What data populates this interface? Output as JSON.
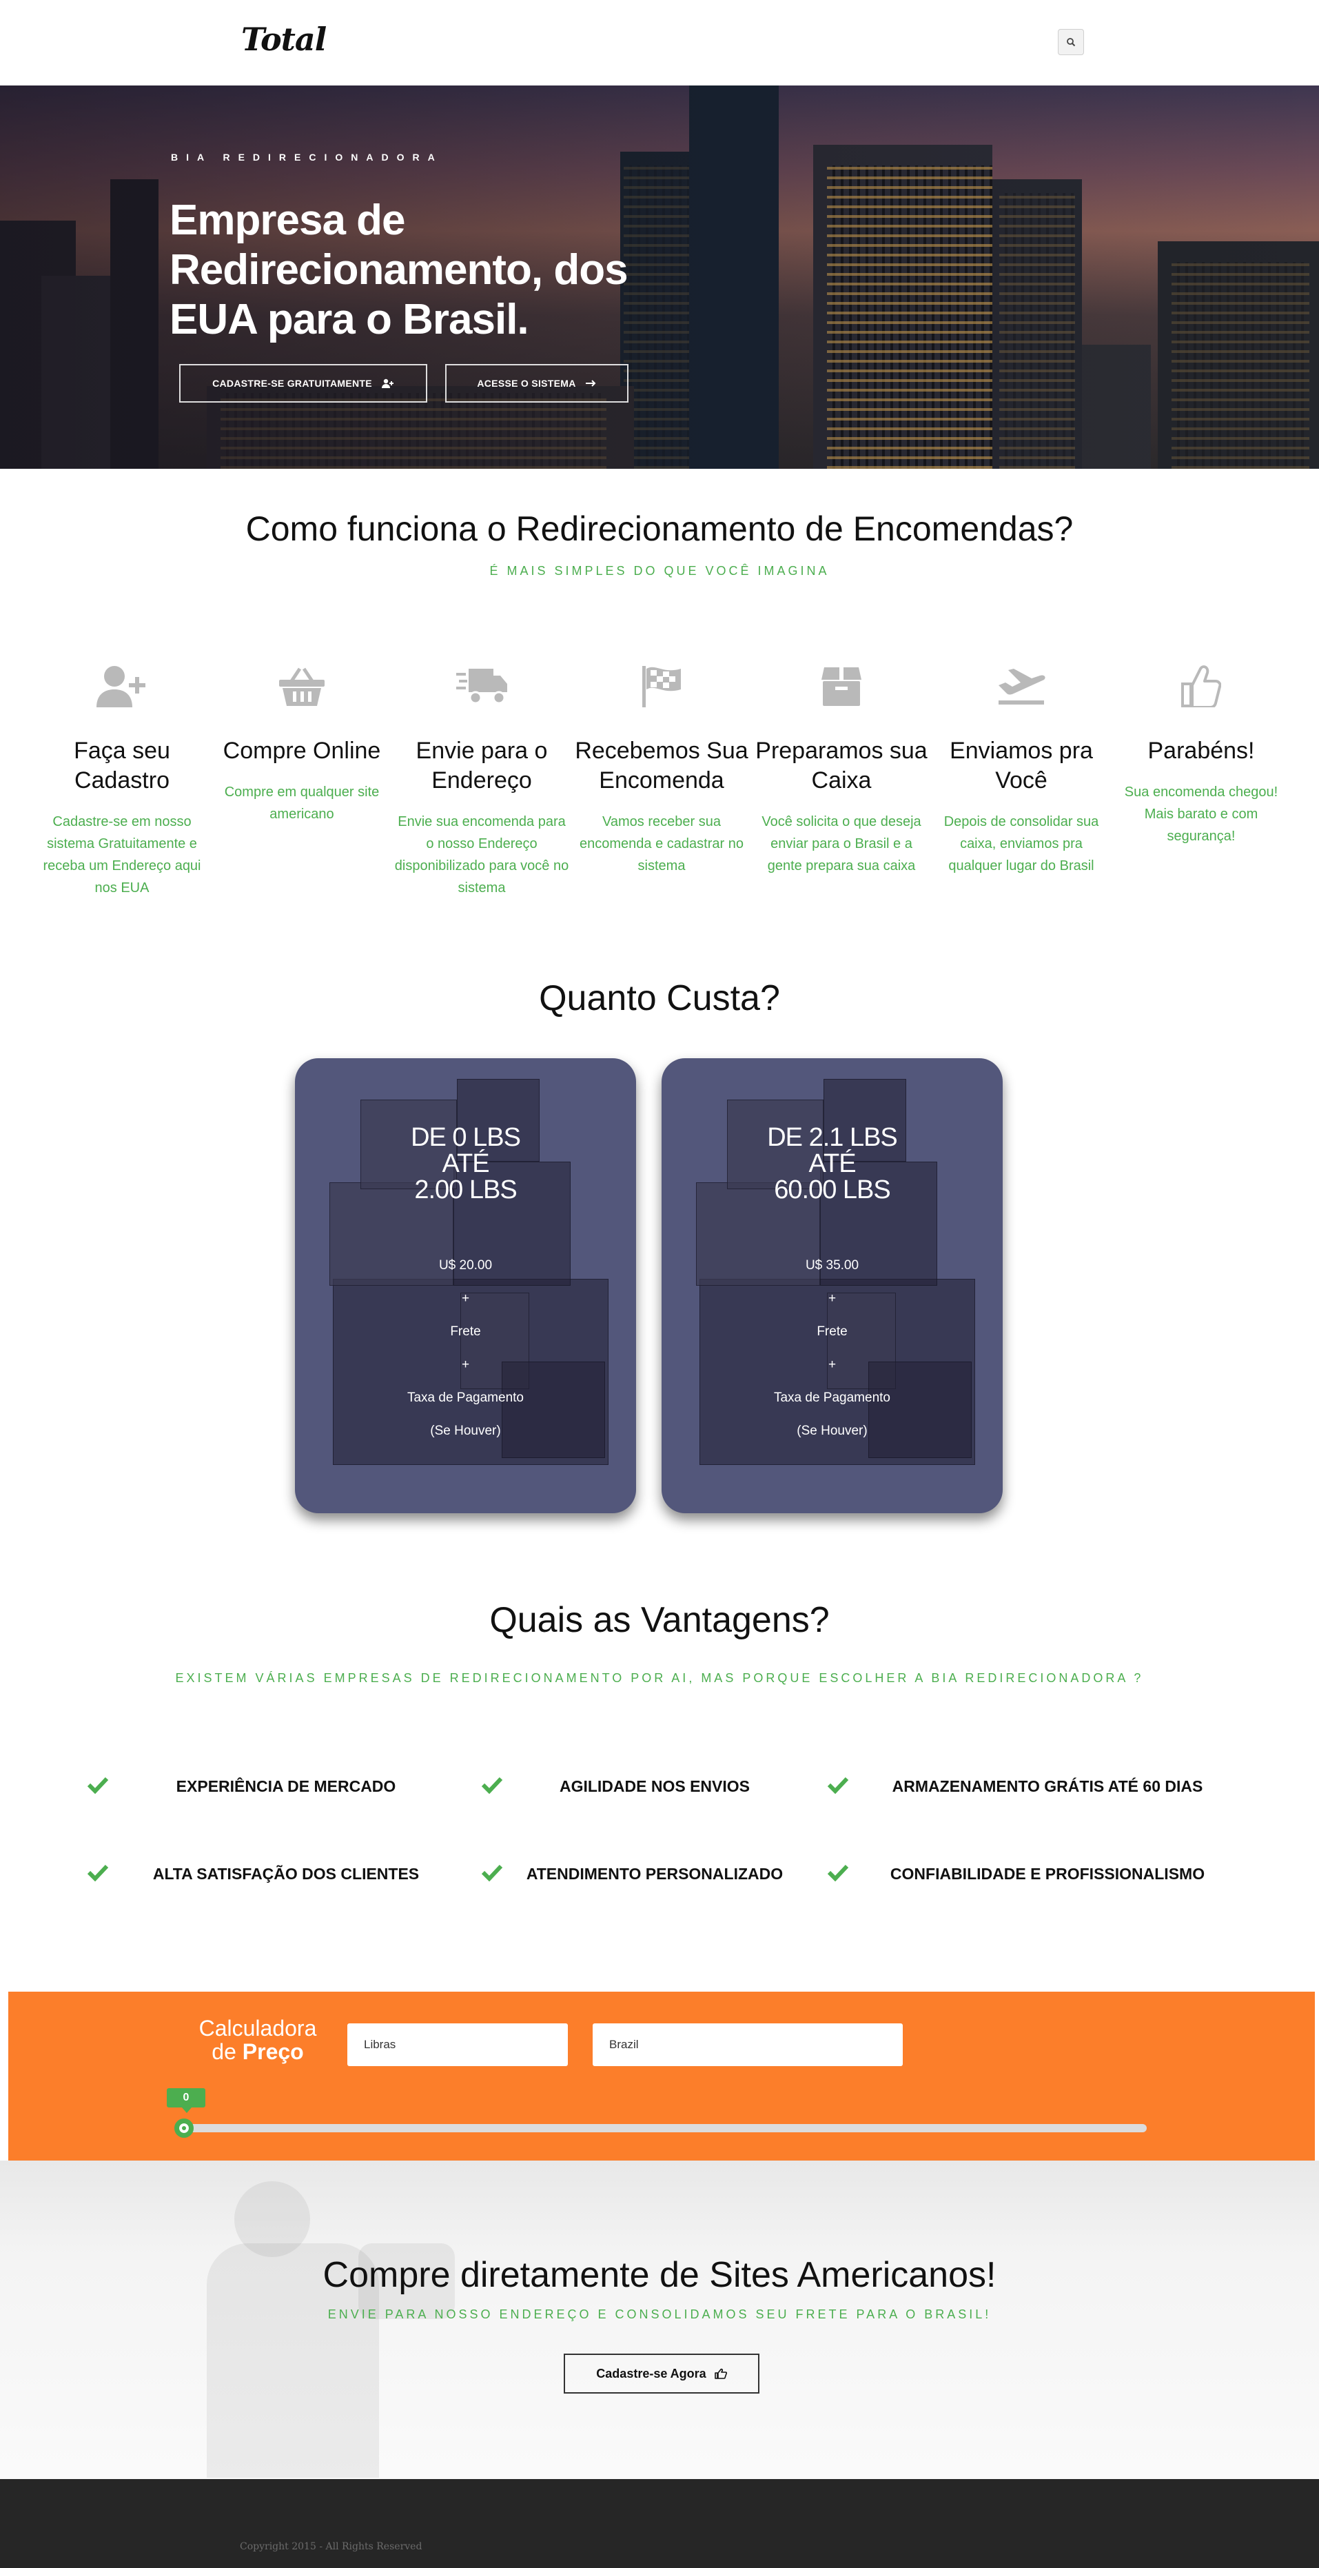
{
  "header": {
    "logo": "Total",
    "search_icon": "search-icon"
  },
  "hero": {
    "kicker": "BIA REDIRECIONADORA",
    "title": "Empresa de Redirecionamento, dos EUA para o Brasil.",
    "btn_signup": "CADASTRE-SE GRATUITAMENTE",
    "btn_signup_icon": "user-plus-icon",
    "btn_login": "ACESSE O SISTEMA",
    "btn_login_icon": "arrow-right-icon"
  },
  "how": {
    "title": "Como funciona o Redirecionamento de Encomendas?",
    "subtitle": "É MAIS SIMPLES DO QUE VOCÊ IMAGINA",
    "steps": [
      {
        "icon": "user-plus-icon",
        "title": "Faça seu Cadastro",
        "text": "Cadastre-se em nosso sistema Gratuitamente e receba um Endereço aqui nos EUA"
      },
      {
        "icon": "shopping-basket-icon",
        "title": "Compre Online",
        "text": "Compre em qualquer site americano"
      },
      {
        "icon": "truck-icon",
        "title": "Envie para o Endereço",
        "text": "Envie sua encomenda para o nosso Endereço disponibilizado para você no sistema"
      },
      {
        "icon": "flag-checkered-icon",
        "title": "Recebemos Sua Encomenda",
        "text": "Vamos receber sua encomenda e cadastrar no sistema"
      },
      {
        "icon": "box-icon",
        "title": "Preparamos sua Caixa",
        "text": "Você solicita o que deseja enviar para o Brasil e a gente prepara sua caixa"
      },
      {
        "icon": "plane-departure-icon",
        "title": "Enviamos pra Você",
        "text": "Depois de consolidar sua caixa, enviamos pra qualquer lugar do Brasil"
      },
      {
        "icon": "thumbs-up-icon",
        "title": "Parabéns!",
        "text": "Sua encomenda chegou! Mais barato e com segurança!"
      }
    ]
  },
  "pricing": {
    "title": "Quanto Custa?",
    "cards": [
      {
        "range_from": "DE 0 LBS",
        "range_mid": "ATÉ",
        "range_to": "2.00 LBS",
        "price": "U$ 20.00",
        "plus1": "+",
        "freight": "Frete",
        "plus2": "+",
        "fee": "Taxa de Pagamento",
        "note": "(Se Houver)"
      },
      {
        "range_from": "DE 2.1 LBS",
        "range_mid": "ATÉ",
        "range_to": "60.00 LBS",
        "price": "U$ 35.00",
        "plus1": "+",
        "freight": "Frete",
        "plus2": "+",
        "fee": "Taxa de Pagamento",
        "note": "(Se Houver)"
      }
    ]
  },
  "advantages": {
    "title": "Quais as Vantagens?",
    "subtitle": "EXISTEM VÁRIAS EMPRESAS DE REDIRECIONAMENTO POR AI, MAS PORQUE ESCOLHER A BIA REDIRECIONADORA ?",
    "items": [
      {
        "label": "EXPERIÊNCIA DE MERCADO",
        "icon": "check-icon"
      },
      {
        "label": "AGILIDADE NOS ENVIOS",
        "icon": "check-icon"
      },
      {
        "label": "ARMAZENAMENTO GRÁTIS ATÉ 60 DIAS",
        "icon": "check-icon"
      },
      {
        "label": "ALTA SATISFAÇÃO DOS CLIENTES",
        "icon": "check-icon"
      },
      {
        "label": "ATENDIMENTO PERSONALIZADO",
        "icon": "check-icon"
      },
      {
        "label": "CONFIABILIDADE E PROFISSIONALISMO",
        "icon": "check-icon"
      }
    ]
  },
  "calculator": {
    "title_line1": "Calculadora",
    "title_line2a": "de ",
    "title_line2b": "Preço",
    "weight_value": "Libras",
    "country_value": "Brazil",
    "slider_value": "0",
    "slider_fraction": 0
  },
  "cta": {
    "title": "Compre diretamente de Sites Americanos!",
    "subtitle": "ENVIE PARA NOSSO ENDEREÇO E CONSOLIDAMOS SEU FRETE PARA O BRASIL!",
    "button": "Cadastre-se Agora",
    "button_icon": "hand-pointing-icon"
  },
  "footer": {
    "copyright": "Copyright 2015 - All Rights Reserved"
  },
  "colors": {
    "accent_green": "#4cae4f",
    "calculator_orange": "#fc7e2a",
    "card_blue": "#53577b",
    "footer_dark": "#262626",
    "icon_gray": "#b9b9b9"
  }
}
